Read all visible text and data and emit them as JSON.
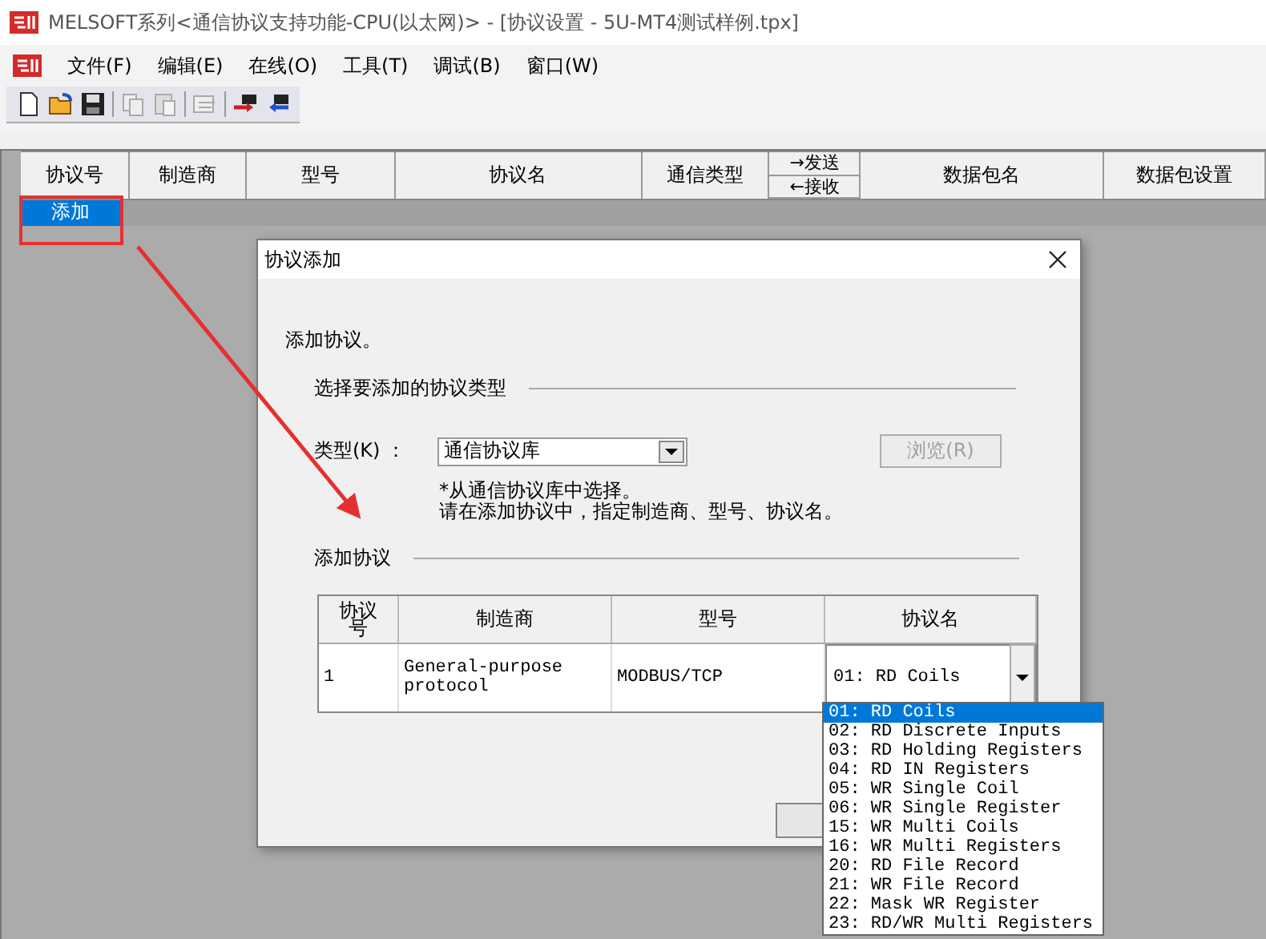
{
  "window": {
    "title": "MELSOFT系列<通信协议支持功能-CPU(以太网)> - [协议设置 - 5U-MT4测试样例.tpx]"
  },
  "menu": [
    {
      "label": "文件(F)"
    },
    {
      "label": "编辑(E)"
    },
    {
      "label": "在线(O)"
    },
    {
      "label": "工具(T)"
    },
    {
      "label": "调试(B)"
    },
    {
      "label": "窗口(W)"
    }
  ],
  "table": {
    "columns": [
      {
        "kind": "text",
        "label": "协议号"
      },
      {
        "kind": "text",
        "label": "制造商"
      },
      {
        "kind": "text",
        "label": "型号"
      },
      {
        "kind": "text",
        "label": "协议名"
      },
      {
        "kind": "text",
        "label": "通信类型"
      },
      {
        "kind": "split",
        "top": "→发送",
        "bottom": "←接收"
      },
      {
        "kind": "text",
        "label": "数据包名"
      },
      {
        "kind": "text",
        "label": "数据包设置"
      }
    ],
    "rows": [
      {
        "label": "添加",
        "selected": true
      }
    ]
  },
  "dialog": {
    "title": "协议添加",
    "intro": "添加协议。",
    "section_type": "选择要添加的协议类型",
    "type_label": "类型(K) ：",
    "type_value": "通信协议库",
    "browse_button": {
      "label": "浏览(R)",
      "disabled": true
    },
    "note": [
      "*从通信协议库中选择。",
      "请在添加协议中，指定制造商、型号、协议名。"
    ],
    "section_add": "添加协议",
    "columns": [
      "协议号",
      "制造商",
      "型号",
      "协议名"
    ],
    "rows": [
      {
        "number": "1",
        "maker": "General-purpose protocol",
        "model": "MODBUS/TCP",
        "protocol": "01: RD Coils"
      }
    ],
    "options": [
      {
        "label": "01: RD Coils",
        "selected": true
      },
      {
        "label": "02: RD Discrete Inputs",
        "selected": false
      },
      {
        "label": "03: RD Holding Registers",
        "selected": false
      },
      {
        "label": "04: RD IN Registers",
        "selected": false
      },
      {
        "label": "05: WR Single Coil",
        "selected": false
      },
      {
        "label": "06: WR Single Register",
        "selected": false
      },
      {
        "label": "15: WR Multi Coils",
        "selected": false
      },
      {
        "label": "16: WR Multi Registers",
        "selected": false
      },
      {
        "label": "20: RD File Record",
        "selected": false
      },
      {
        "label": "21: WR File Record",
        "selected": false
      },
      {
        "label": "22: Mask WR Register",
        "selected": false
      },
      {
        "label": "23: RD/WR Multi Registers",
        "selected": false
      }
    ]
  }
}
